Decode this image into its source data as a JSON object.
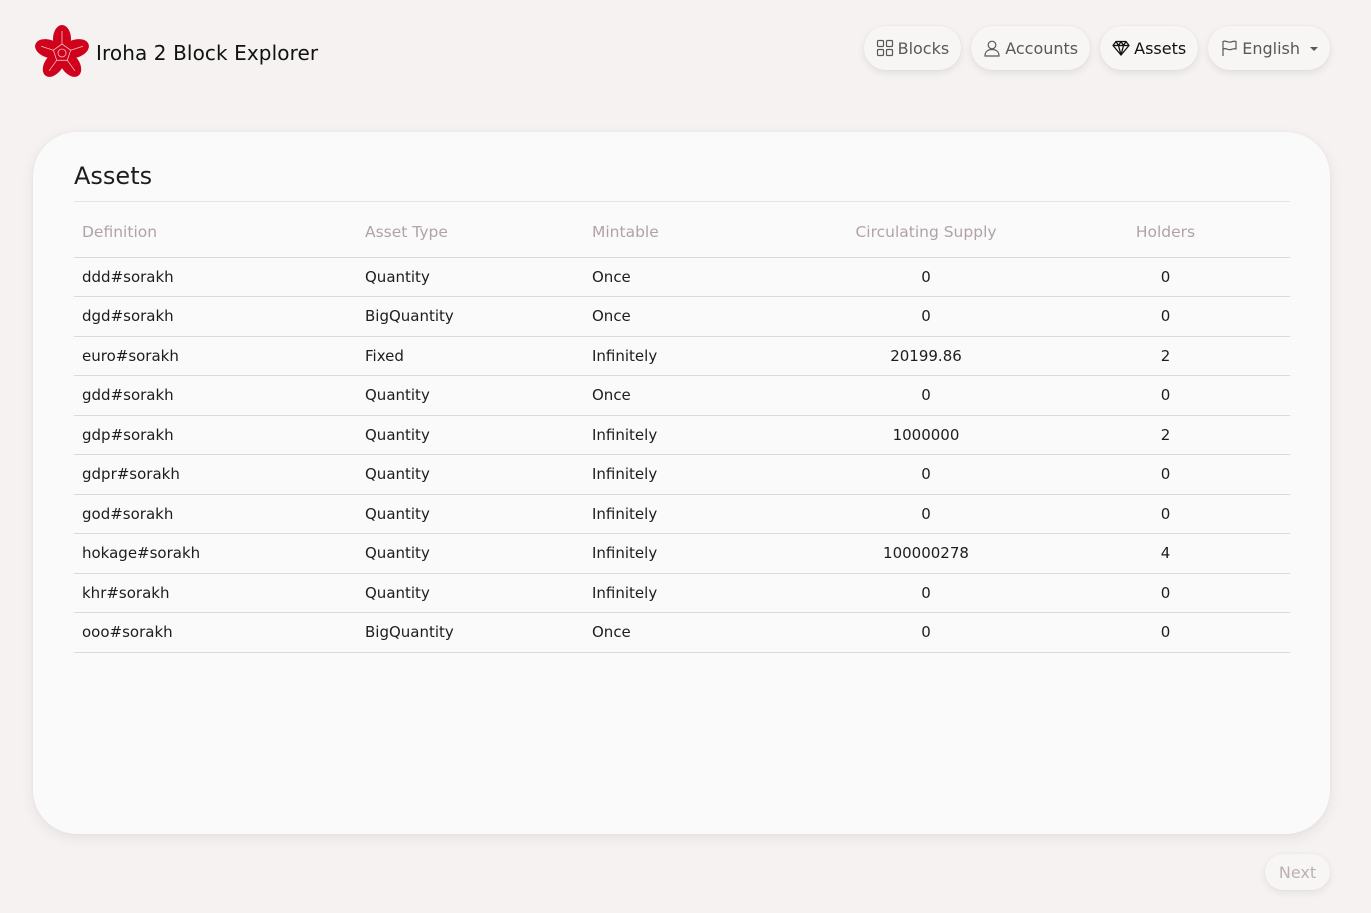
{
  "app": {
    "title": "Iroha 2 Block Explorer"
  },
  "nav": {
    "items": [
      {
        "label": "Blocks",
        "icon": "grid-icon"
      },
      {
        "label": "Accounts",
        "icon": "user-icon"
      },
      {
        "label": "Assets",
        "icon": "diamond-icon",
        "active": true
      }
    ],
    "language": {
      "label": "English",
      "icon": "flag-icon"
    }
  },
  "assets": {
    "title": "Assets",
    "columns": [
      "Definition",
      "Asset Type",
      "Mintable",
      "Circulating Supply",
      "Holders"
    ],
    "rows": [
      [
        "ddd#sorakh",
        "Quantity",
        "Once",
        "0",
        "0"
      ],
      [
        "dgd#sorakh",
        "BigQuantity",
        "Once",
        "0",
        "0"
      ],
      [
        "euro#sorakh",
        "Fixed",
        "Infinitely",
        "20199.86",
        "2"
      ],
      [
        "gdd#sorakh",
        "Quantity",
        "Once",
        "0",
        "0"
      ],
      [
        "gdp#sorakh",
        "Quantity",
        "Infinitely",
        "1000000",
        "2"
      ],
      [
        "gdpr#sorakh",
        "Quantity",
        "Infinitely",
        "0",
        "0"
      ],
      [
        "god#sorakh",
        "Quantity",
        "Infinitely",
        "0",
        "0"
      ],
      [
        "hokage#sorakh",
        "Quantity",
        "Infinitely",
        "100000278",
        "4"
      ],
      [
        "khr#sorakh",
        "Quantity",
        "Infinitely",
        "0",
        "0"
      ],
      [
        "ooo#sorakh",
        "BigQuantity",
        "Once",
        "0",
        "0"
      ]
    ]
  },
  "pagination": {
    "next_label": "Next"
  },
  "colors": {
    "brand": "#d0021b",
    "background": "#f5f2f1",
    "header_text": "#b1a3a5"
  }
}
